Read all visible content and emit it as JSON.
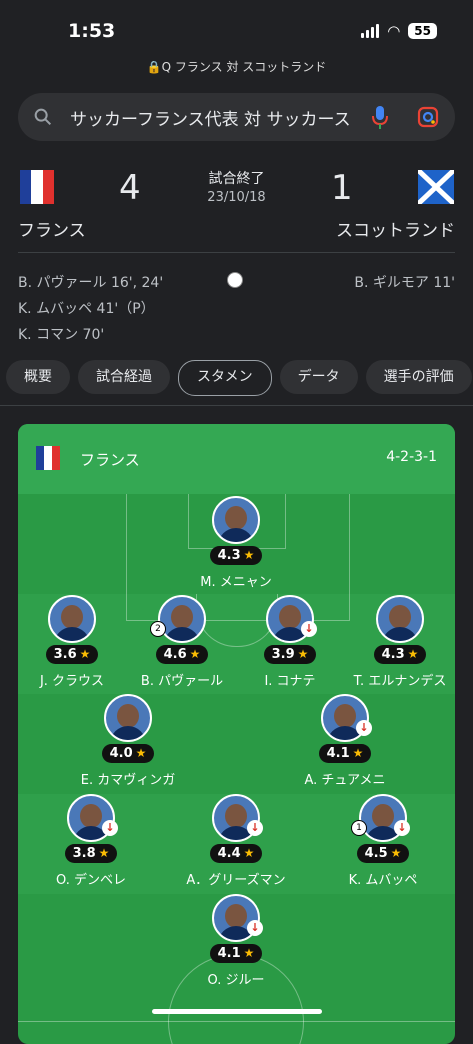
{
  "status": {
    "time": "1:53",
    "battery": "55"
  },
  "url": "🔒Q フランス 対 スコットランド",
  "search": {
    "query": "サッカーフランス代表 対 サッカース"
  },
  "match": {
    "status": "試合終了",
    "date": "23/10/18",
    "home": {
      "name": "フランス",
      "score": "4"
    },
    "away": {
      "name": "スコットランド",
      "score": "1"
    },
    "home_scorers": [
      "B. パヴァール 16', 24'",
      "K. ムバッペ 41'（P）",
      "K. コマン 70'"
    ],
    "away_scorers": [
      "B. ギルモア 11'"
    ]
  },
  "tabs": [
    "概要",
    "試合経過",
    "スタメン",
    "データ",
    "選手の評価"
  ],
  "lineup": {
    "team": "フランス",
    "formation": "4-2-3-1",
    "players": [
      {
        "name": "M. メニャン",
        "rating": "4.3",
        "sub": false,
        "goal": ""
      },
      {
        "name": "J. クラウス",
        "rating": "3.6",
        "sub": false,
        "goal": ""
      },
      {
        "name": "B. パヴァール",
        "rating": "4.6",
        "sub": false,
        "goal": "2"
      },
      {
        "name": "I. コナテ",
        "rating": "3.9",
        "sub": true,
        "goal": ""
      },
      {
        "name": "T. エルナンデス",
        "rating": "4.3",
        "sub": false,
        "goal": ""
      },
      {
        "name": "E. カマヴィンガ",
        "rating": "4.0",
        "sub": false,
        "goal": ""
      },
      {
        "name": "A. チュアメニ",
        "rating": "4.1",
        "sub": true,
        "goal": ""
      },
      {
        "name": "O. デンベレ",
        "rating": "3.8",
        "sub": true,
        "goal": ""
      },
      {
        "name": "A．グリーズマン",
        "rating": "4.4",
        "sub": true,
        "goal": ""
      },
      {
        "name": "K. ムバッペ",
        "rating": "4.5",
        "sub": true,
        "goal": "1"
      },
      {
        "name": "O. ジルー",
        "rating": "4.1",
        "sub": true,
        "goal": ""
      }
    ]
  },
  "colors": {
    "pitch": "#2a9a45",
    "accent": "#fbbc04",
    "background": "#202124"
  }
}
